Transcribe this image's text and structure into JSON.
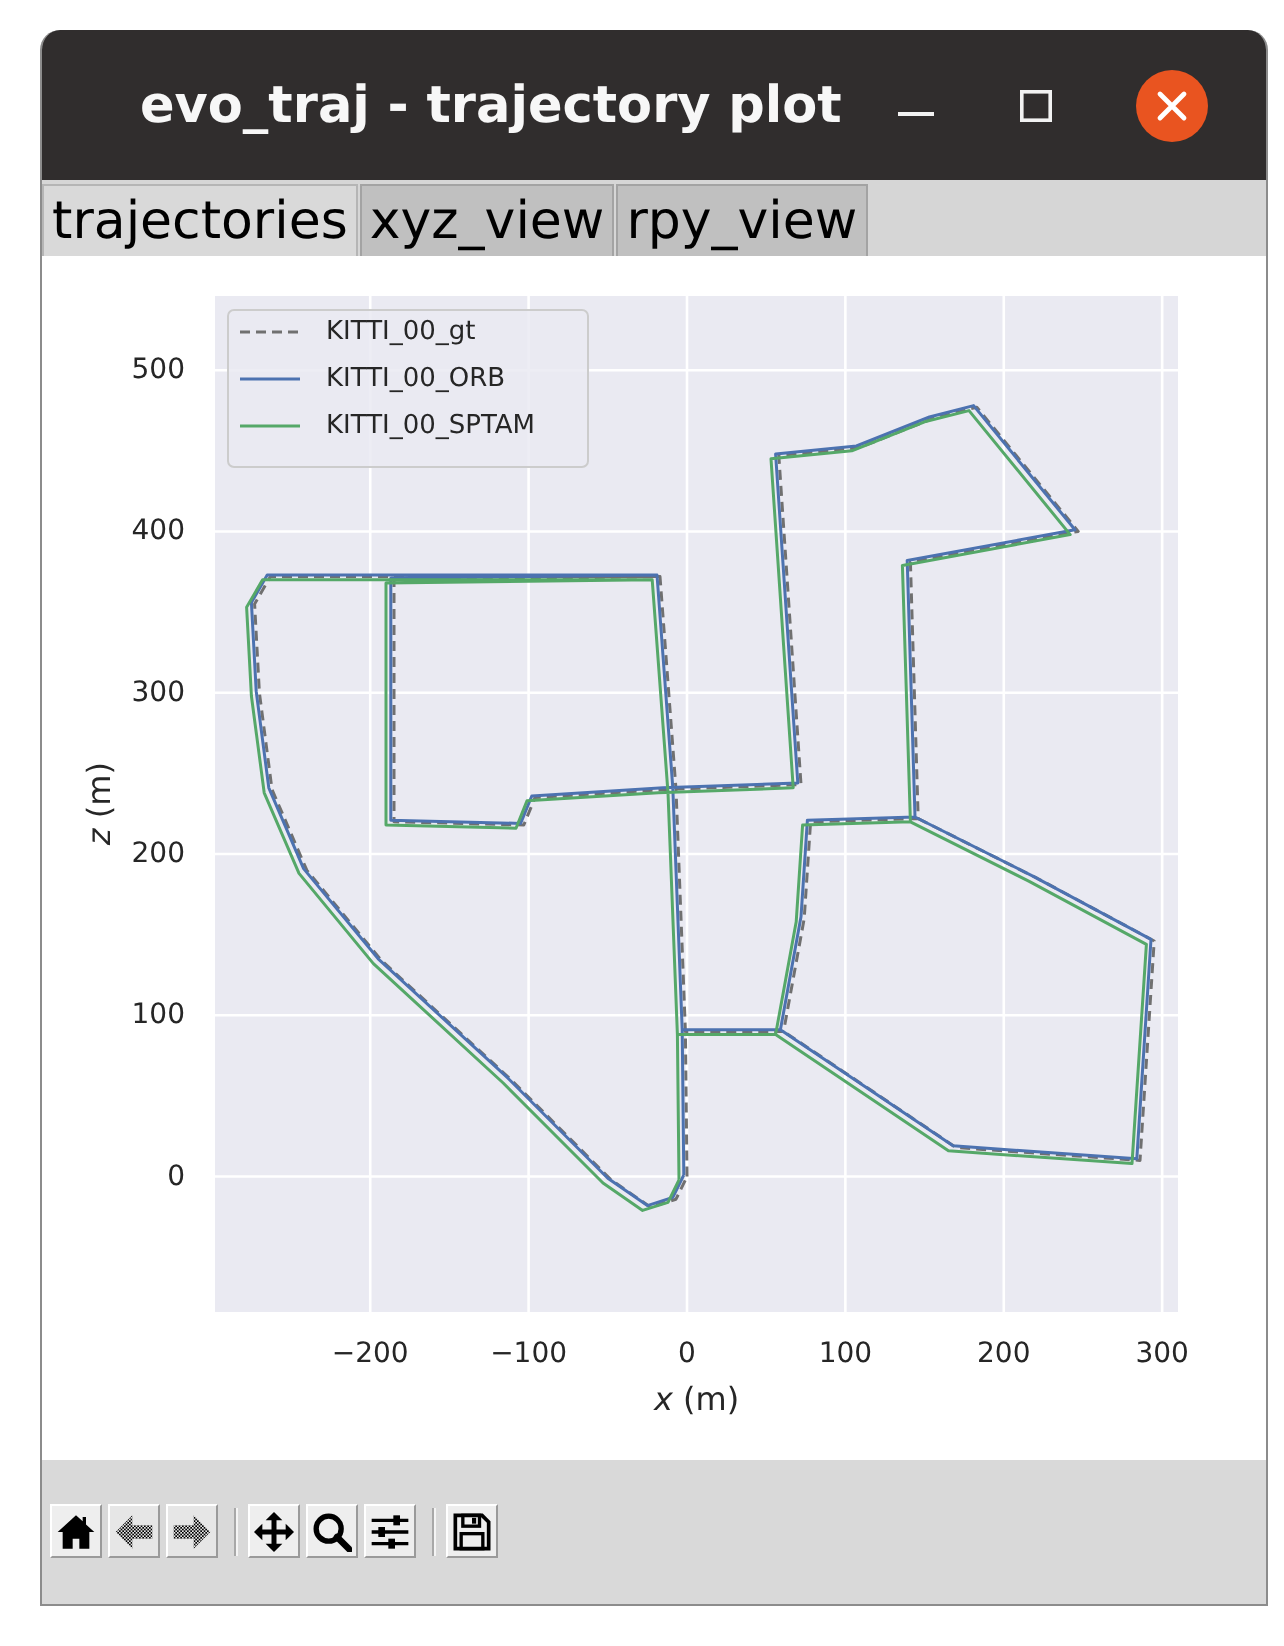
{
  "window": {
    "title": "evo_traj - trajectory plot"
  },
  "tabs": [
    {
      "label": "trajectories",
      "selected": true
    },
    {
      "label": "xyz_view",
      "selected": false
    },
    {
      "label": "rpy_view",
      "selected": false
    }
  ],
  "figure": {
    "chart_data": {
      "type": "line",
      "xlabel": "*x* (m)",
      "ylabel": "*z* (m)",
      "xlim": [
        -298,
        310
      ],
      "ylim": [
        -84,
        546
      ],
      "xticks": [
        {
          "value": -200,
          "label": "−200"
        },
        {
          "value": -100,
          "label": "−100"
        },
        0,
        100,
        200,
        300
      ],
      "yticks": [
        0,
        100,
        200,
        300,
        400,
        500
      ],
      "grid": true,
      "legend": true,
      "series": [
        {
          "name": "KITTI_00_gt",
          "color": "#707070",
          "line_style": "dashed",
          "x": [
            0,
            -1,
            -7,
            -17,
            -185,
            -185,
            -103,
            -96,
            -13,
            72,
            58,
            109,
            155,
            183,
            247,
            141,
            146,
            78,
            74,
            61,
            -1,
            null,
            146,
            221,
            295,
            286,
            170,
            61,
            null,
            -17,
            -263,
            -273,
            -270,
            -262,
            -240,
            -193,
            -111,
            -48,
            -23,
            -7,
            0
          ],
          "values": [
            0,
            90,
            240,
            372,
            370,
            220,
            218,
            235,
            240,
            243,
            447,
            452,
            470,
            477,
            400,
            381,
            222,
            220,
            160,
            90,
            90,
            null,
            222,
            185,
            146,
            10,
            18,
            90,
            null,
            372,
            372,
            355,
            300,
            240,
            190,
            134,
            60,
            -2,
            -19,
            -14,
            0
          ]
        },
        {
          "name": "KITTI_00_ORB",
          "color": "#4c72b0",
          "line_style": "solid",
          "x": [
            -2,
            -3,
            -9,
            -19,
            -187,
            -187,
            -105,
            -98,
            -15,
            70,
            56,
            107,
            153,
            181,
            245,
            139,
            144,
            76,
            72,
            59,
            -3,
            null,
            144,
            219,
            293,
            284,
            168,
            59,
            null,
            -19,
            -265,
            -275,
            -272,
            -264,
            -242,
            -195,
            -113,
            -50,
            -25,
            -9,
            -2
          ],
          "values": [
            1,
            91,
            241,
            373,
            371,
            221,
            219,
            236,
            241,
            244,
            448,
            453,
            471,
            478,
            401,
            382,
            223,
            221,
            161,
            91,
            91,
            null,
            223,
            186,
            147,
            11,
            19,
            91,
            null,
            373,
            373,
            356,
            301,
            241,
            191,
            135,
            61,
            -1,
            -18,
            -13,
            1
          ]
        },
        {
          "name": "KITTI_00_SPTAM",
          "color": "#55a868",
          "line_style": "solid",
          "x": [
            -5,
            -6,
            -12,
            -22,
            -190,
            -190,
            -108,
            -101,
            -18,
            67,
            53,
            104,
            150,
            178,
            242,
            136,
            141,
            73,
            69,
            56,
            -6,
            null,
            141,
            216,
            290,
            281,
            165,
            56,
            null,
            -22,
            -268,
            -278,
            -275,
            -267,
            -245,
            -198,
            -116,
            -53,
            -28,
            -12,
            -5
          ],
          "values": [
            -2,
            88,
            238,
            370,
            368,
            218,
            216,
            233,
            238,
            241,
            445,
            450,
            468,
            475,
            398,
            379,
            220,
            218,
            158,
            88,
            88,
            null,
            220,
            183,
            144,
            8,
            16,
            88,
            null,
            370,
            370,
            353,
            298,
            238,
            188,
            132,
            58,
            -4,
            -21,
            -16,
            -2
          ]
        }
      ]
    }
  },
  "toolbar": {
    "groups": [
      [
        {
          "disabled": false
        },
        {
          "disabled": true
        },
        {
          "disabled": true
        }
      ],
      [
        {
          "disabled": false
        },
        {
          "disabled": false
        },
        {
          "disabled": false
        }
      ],
      [
        {
          "disabled": false
        }
      ]
    ]
  }
}
